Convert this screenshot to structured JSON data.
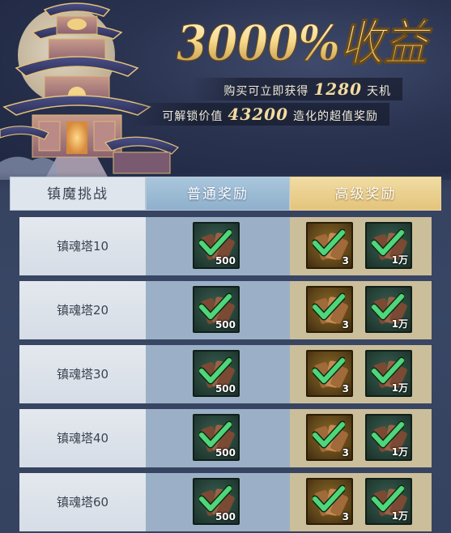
{
  "banner": {
    "headline": "3000%收益",
    "line1": {
      "pre": "购买可立即获得",
      "value": "1280",
      "post": "天机"
    },
    "line2": {
      "pre": "可解锁价值",
      "value": "43200",
      "post": "造化的超值奖励"
    }
  },
  "table": {
    "headers": {
      "challenge": "镇魔挑战",
      "normal": "普通奖励",
      "premium": "高级奖励"
    },
    "rows": [
      {
        "label": "镇魂塔10",
        "normal_qty": "500",
        "premium_qty_1": "3",
        "premium_qty_2": "1万"
      },
      {
        "label": "镇魂塔20",
        "normal_qty": "500",
        "premium_qty_1": "3",
        "premium_qty_2": "1万"
      },
      {
        "label": "镇魂塔30",
        "normal_qty": "500",
        "premium_qty_1": "3",
        "premium_qty_2": "1万"
      },
      {
        "label": "镇魂塔40",
        "normal_qty": "500",
        "premium_qty_1": "3",
        "premium_qty_2": "1万"
      },
      {
        "label": "镇魂塔60",
        "normal_qty": "500",
        "premium_qty_1": "3",
        "premium_qty_2": "1万"
      }
    ]
  },
  "colors": {
    "check": "#4fd67a",
    "gold_text": "#f3dca0",
    "premium_header": "#e3c47c",
    "normal_header": "#8fb0cc"
  },
  "icons": {
    "reward_item": "scroll-bundle-icon",
    "claimed": "checkmark-icon",
    "currency": "gold-ingot-icon"
  }
}
